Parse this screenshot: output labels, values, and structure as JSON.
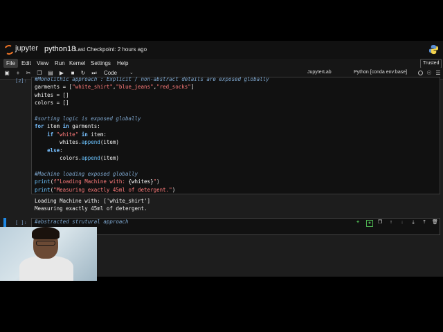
{
  "header": {
    "logo_text": "jupyter",
    "notebook_name": "python18",
    "checkpoint": "Last Checkpoint: 2 hours ago"
  },
  "menu": {
    "items": [
      "File",
      "Edit",
      "View",
      "Run",
      "Kernel",
      "Settings",
      "Help"
    ],
    "active": "File",
    "trusted": "Trusted"
  },
  "toolbar": {
    "cell_type": "Code",
    "jupyterlab": "JupyterLab",
    "kernel": "Python [conda env:base]"
  },
  "cells": {
    "cell1": {
      "prompt": "[2]:",
      "line0": "#Monolithic approach : Explicit / non-abstract details are exposed globally",
      "output": [
        "Loading Machine with: ['white_shirt']",
        "Measuring exactly 45ml of detergent."
      ]
    },
    "cell2": {
      "prompt": "[ ]:",
      "code": "#abstracted strutural approach"
    }
  },
  "colors": {
    "accent_blue": "#1e88e5",
    "jupyter_orange": "#f37626"
  }
}
